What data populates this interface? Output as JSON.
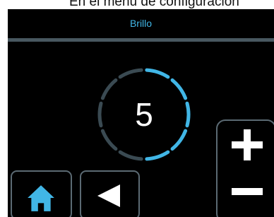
{
  "caption": "En el menú de configuración",
  "screen": {
    "title": "Brillo",
    "setting": {
      "value": "5",
      "level": 5,
      "max": 10
    }
  },
  "colors": {
    "accent": "#41b6e6",
    "dim": "#3a4a52",
    "background": "#000000",
    "text": "#ffffff"
  },
  "icons": {
    "home": "home-icon",
    "back": "triangle-left-icon",
    "increase": "plus-icon",
    "decrease": "minus-icon"
  }
}
